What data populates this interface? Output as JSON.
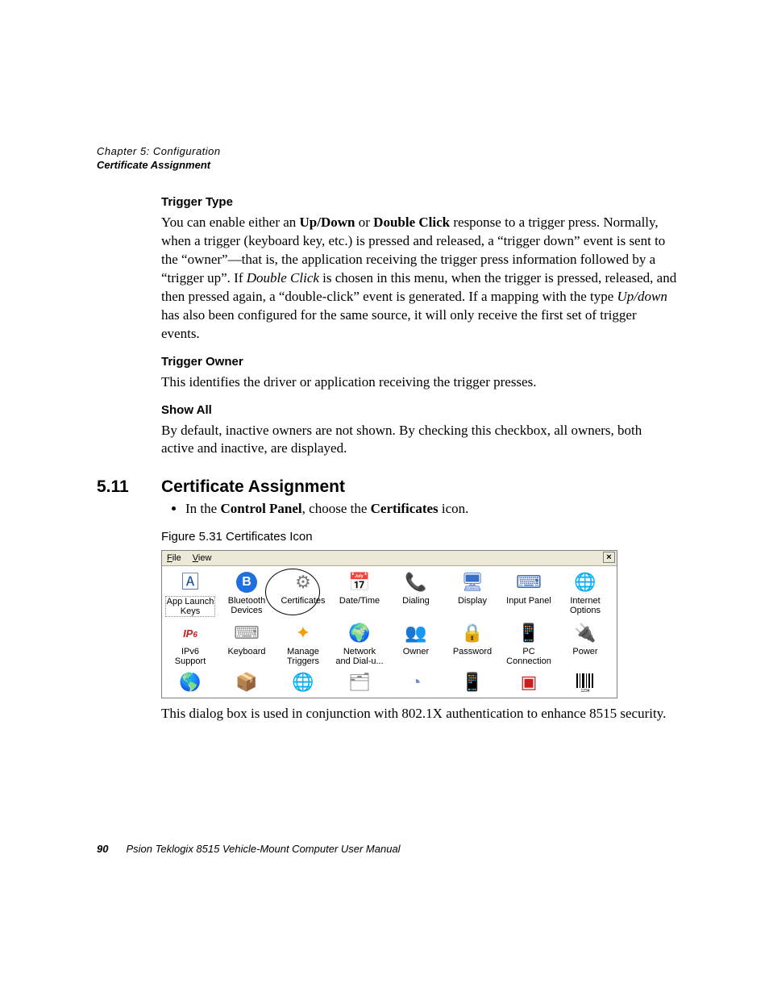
{
  "header": {
    "chapter_line": "Chapter  5:  Configuration",
    "section_line": "Certificate Assignment"
  },
  "s1": {
    "h": "Trigger Type",
    "p_pre": "You can enable either an ",
    "p_b1": "Up/Down",
    "p_mid1": " or ",
    "p_b2": "Double Click",
    "p_mid2": " response to a trigger press. Normally, when a trigger (keyboard key, etc.) is pressed and released, a “trigger down” event is sent to the “owner”—that is, the application receiving the trigger press information followed by a “trigger up”. If ",
    "p_i1": "Double Click",
    "p_mid3": " is chosen in this menu, when the trigger is pressed, released, and then pressed again, a “double-click” event is generated. If a mapping with the type ",
    "p_i2": "Up/down",
    "p_end": " has also been configured for the same source, it will only receive the first set of trigger events."
  },
  "s2": {
    "h": "Trigger Owner",
    "p": "This identifies the driver or application receiving the trigger presses."
  },
  "s3": {
    "h": "Show All",
    "p": "By default, inactive owners are not shown. By checking this checkbox, all owners, both active and inactive, are displayed."
  },
  "sec": {
    "num": "5.11",
    "title": "Certificate Assignment",
    "bullet_pre": "In the ",
    "bullet_b1": "Control Panel",
    "bullet_mid": ", choose the ",
    "bullet_b2": "Certificates",
    "bullet_end": " icon.",
    "fig_caption": "Figure 5.31 Certificates Icon",
    "after_fig": "This dialog box is used in conjunction with 802.1X authentication to enhance 8515 security."
  },
  "cp": {
    "menu_file": "File",
    "menu_view": "View",
    "close": "×",
    "items_row1": [
      {
        "name": "app-launch-keys-icon",
        "label": "App Launch\nKeys",
        "glyph": "🄰",
        "color": "#1a4fa0",
        "selected": true
      },
      {
        "name": "bluetooth-devices-icon",
        "label": "Bluetooth\nDevices",
        "glyph": "B",
        "color": "#fff",
        "bg": "#1e6fe0",
        "round": true
      },
      {
        "name": "certificates-icon",
        "label": "Certificates",
        "glyph": "⚙",
        "color": "#7a7a7a"
      },
      {
        "name": "date-time-icon",
        "label": "Date/Time",
        "glyph": "📅",
        "color": "#5b8fd6"
      },
      {
        "name": "dialing-icon",
        "label": "Dialing",
        "glyph": "📞",
        "color": "#1a8f3a"
      },
      {
        "name": "display-icon",
        "label": "Display",
        "glyph": "🖥",
        "color": "#3a6fc7"
      },
      {
        "name": "input-panel-icon",
        "label": "Input Panel",
        "glyph": "⌨",
        "color": "#3a6fc7"
      },
      {
        "name": "internet-options-icon",
        "label": "Internet\nOptions",
        "glyph": "🌐",
        "color": "#2a7fbf"
      }
    ],
    "items_row2": [
      {
        "name": "ipv6-support-icon",
        "label": "IPv6\nSupport",
        "glyph": "IP6",
        "color": "#c81e1e",
        "text": true
      },
      {
        "name": "keyboard-icon",
        "label": "Keyboard",
        "glyph": "⌨",
        "color": "#888"
      },
      {
        "name": "manage-triggers-icon",
        "label": "Manage\nTriggers",
        "glyph": "✦",
        "color": "#f0a000"
      },
      {
        "name": "network-dialup-icon",
        "label": "Network\nand Dial-u...",
        "glyph": "🌍",
        "color": "#1a8f3a"
      },
      {
        "name": "owner-icon",
        "label": "Owner",
        "glyph": "👥",
        "color": "#3a6fc7"
      },
      {
        "name": "password-icon",
        "label": "Password",
        "glyph": "🔒",
        "color": "#d4a017"
      },
      {
        "name": "pc-connection-icon",
        "label": "PC\nConnection",
        "glyph": "📱",
        "color": "#3a9f5a"
      },
      {
        "name": "power-icon",
        "label": "Power",
        "glyph": "🔌",
        "color": "#6a8fbf"
      }
    ],
    "items_row3": [
      {
        "name": "regional-settings-icon",
        "label": "",
        "glyph": "🌎",
        "color": "#3a6fc7"
      },
      {
        "name": "remove-programs-icon",
        "label": "",
        "glyph": "📦",
        "color": "#c88a3a"
      },
      {
        "name": "scanners-icon",
        "label": "",
        "glyph": "🌐",
        "color": "#2a7fbf"
      },
      {
        "name": "storage-manager-icon",
        "label": "",
        "glyph": "🗂",
        "color": "#888"
      },
      {
        "name": "stylus-icon",
        "label": "",
        "glyph": "◔",
        "color": "#6a8fbf"
      },
      {
        "name": "system-icon",
        "label": "",
        "glyph": "📱",
        "color": "#d4a017"
      },
      {
        "name": "total-recall-icon",
        "label": "",
        "glyph": "▣",
        "color": "#c81e1e"
      },
      {
        "name": "volume-sounds-icon",
        "label": "",
        "glyph": "📶",
        "color": "#000",
        "barcode": true
      }
    ]
  },
  "footer": {
    "page": "90",
    "title": "Psion Teklogix 8515 Vehicle-Mount Computer User Manual"
  }
}
